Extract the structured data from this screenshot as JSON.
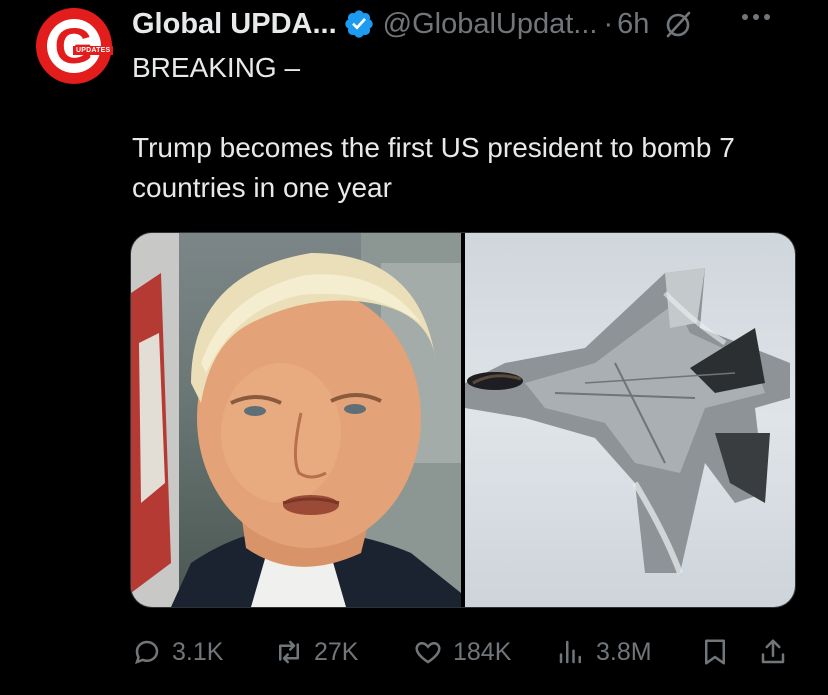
{
  "account": {
    "display_name": "Global UPDA...",
    "handle": "@GlobalUpdat...",
    "separator": "·",
    "time": "6h",
    "avatar_letter": "G",
    "avatar_tag": "UPDATES",
    "verified": true
  },
  "tweet": {
    "line1": "BREAKING –",
    "line2": "Trump becomes the first US president to bomb 7 countries in one year"
  },
  "media": {
    "left_image": "portrait photo of Donald Trump",
    "right_image": "F-22 fighter jet in flight"
  },
  "actions": {
    "replies": "3.1K",
    "reposts": "27K",
    "likes": "184K",
    "views": "3.8M"
  },
  "icons": {
    "verified": "verified-badge-icon",
    "grok": "grok-icon",
    "more": "more-icon",
    "reply": "reply-icon",
    "repost": "repost-icon",
    "like": "heart-icon",
    "views": "views-icon",
    "bookmark": "bookmark-icon",
    "share": "share-icon"
  },
  "colors": {
    "background": "#000000",
    "text": "#e7e9ea",
    "muted": "#71767b",
    "verified": "#1d9bf0",
    "avatar_red": "#e31c1c"
  }
}
